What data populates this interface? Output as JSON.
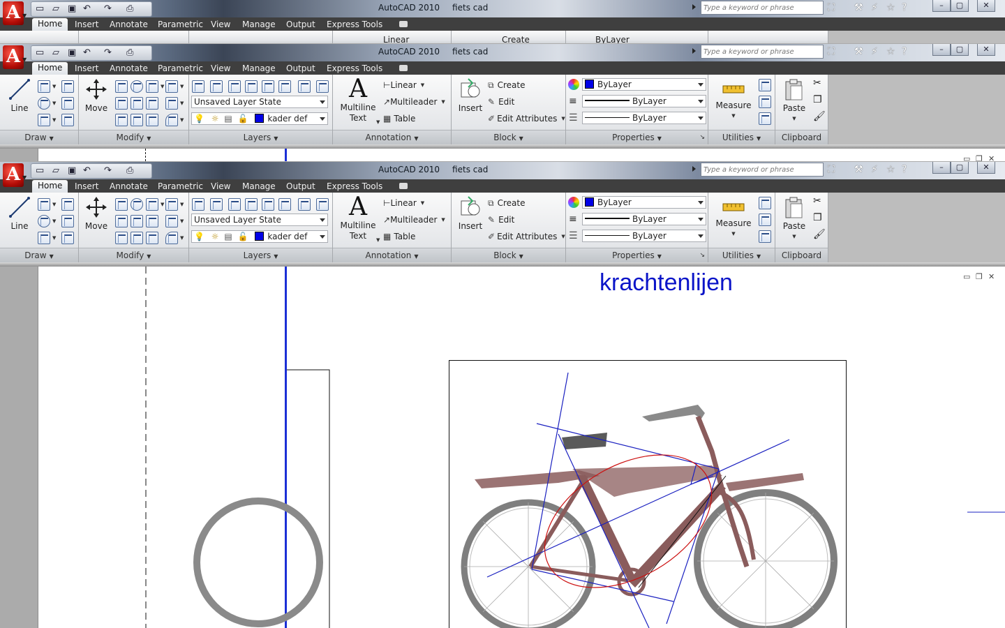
{
  "app": {
    "title": "AutoCAD 2010",
    "document": "fiets cad",
    "search_placeholder": "Type a keyword or phrase",
    "app_letter": "A"
  },
  "qat": {
    "new_icon": "new-file-icon",
    "open_icon": "open-folder-icon",
    "save_icon": "save-icon",
    "undo_icon": "undo-icon",
    "redo_icon": "redo-icon",
    "plot_icon": "printer-icon"
  },
  "tabs": [
    "Home",
    "Insert",
    "Annotate",
    "Parametric",
    "View",
    "Manage",
    "Output",
    "Express Tools"
  ],
  "panels": {
    "draw": {
      "title": "Draw",
      "line_label": "Line"
    },
    "modify": {
      "title": "Modify",
      "move_label": "Move"
    },
    "layers": {
      "title": "Layers",
      "layer_state": "Unsaved Layer State",
      "current_layer": "kader def"
    },
    "annotation": {
      "title": "Annotation",
      "multiline_1": "Multiline",
      "multiline_2": "Text",
      "linear": "Linear",
      "multileader": "Multileader",
      "table": "Table"
    },
    "block": {
      "title": "Block",
      "insert": "Insert",
      "create": "Create",
      "edit": "Edit",
      "edit_attributes": "Edit Attributes"
    },
    "properties": {
      "title": "Properties",
      "color": "ByLayer",
      "lineweight": "ByLayer",
      "linetype": "ByLayer"
    },
    "utilities": {
      "title": "Utilities",
      "measure": "Measure"
    },
    "clipboard": {
      "title": "Clipboard",
      "paste": "Paste"
    }
  },
  "drawing": {
    "heading": "krachtenlijen"
  },
  "colors": {
    "ribbon_dark": "#3f3f3f",
    "heading_blue": "#0a14c8",
    "frame_blue": "#1b2fd6",
    "force_line": "#1a20c0",
    "ellipse": "#cc1010",
    "bike_frame": "#8a5c5c"
  }
}
